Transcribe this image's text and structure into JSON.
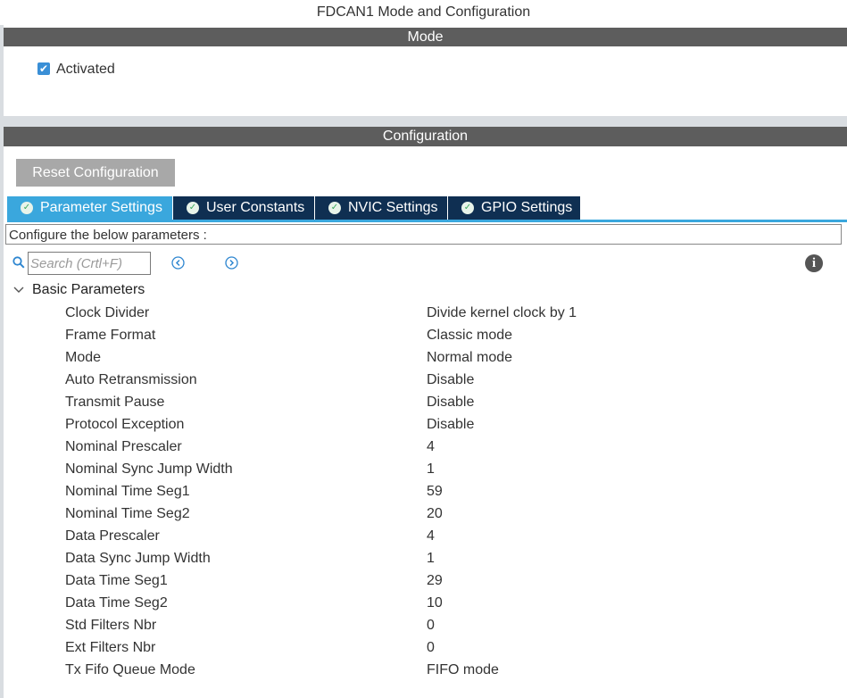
{
  "title": "FDCAN1 Mode and Configuration",
  "mode_section": {
    "header": "Mode",
    "activated_label": "Activated",
    "activated_checked": true
  },
  "config_section": {
    "header": "Configuration",
    "reset_label": "Reset Configuration",
    "tabs": [
      {
        "label": "Parameter Settings",
        "active": true
      },
      {
        "label": "User Constants",
        "active": false
      },
      {
        "label": "NVIC Settings",
        "active": false
      },
      {
        "label": "GPIO Settings",
        "active": false
      }
    ],
    "configure_text": "Configure the below parameters :",
    "search_placeholder": "Search (Crtl+F)",
    "group": {
      "label": "Basic Parameters",
      "params": [
        {
          "name": "Clock Divider",
          "value": "Divide kernel clock by 1"
        },
        {
          "name": "Frame Format",
          "value": "Classic mode"
        },
        {
          "name": "Mode",
          "value": "Normal mode"
        },
        {
          "name": "Auto Retransmission",
          "value": "Disable"
        },
        {
          "name": "Transmit Pause",
          "value": "Disable"
        },
        {
          "name": "Protocol Exception",
          "value": "Disable"
        },
        {
          "name": "Nominal Prescaler",
          "value": "4"
        },
        {
          "name": "Nominal Sync Jump Width",
          "value": "1"
        },
        {
          "name": "Nominal Time Seg1",
          "value": "59"
        },
        {
          "name": "Nominal Time Seg2",
          "value": "20"
        },
        {
          "name": "Data Prescaler",
          "value": "4"
        },
        {
          "name": "Data Sync Jump Width",
          "value": "1"
        },
        {
          "name": "Data Time Seg1",
          "value": "29"
        },
        {
          "name": "Data Time Seg2",
          "value": "10"
        },
        {
          "name": "Std Filters Nbr",
          "value": "0"
        },
        {
          "name": "Ext Filters Nbr",
          "value": "0"
        },
        {
          "name": "Tx Fifo Queue Mode",
          "value": "FIFO mode"
        }
      ]
    }
  },
  "colors": {
    "section_bar": "#5d5d5d",
    "tab_active": "#3aa7dd",
    "tab_inactive": "#0f2f52",
    "checkbox": "#3a8fd6"
  },
  "icons": [
    "check-icon",
    "tab-status-icon",
    "search-icon",
    "previous-icon",
    "next-icon",
    "info-icon",
    "chevron-down-icon"
  ]
}
